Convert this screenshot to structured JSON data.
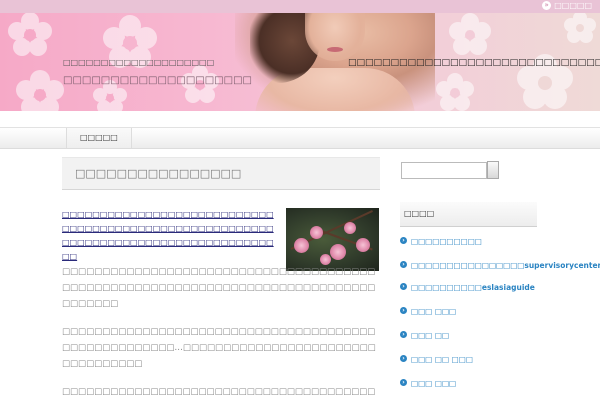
{
  "topbar": {
    "link_label": "□□□□□"
  },
  "header": {
    "site_subtitle": "□□□□□□□□□□□□□□□□□□□□",
    "site_title": "□□□□□□□□□□□□□□□□□□□□",
    "tagline": "□□□□□□□□□□□□□□□□□□□□□□□□□□□□□□□□"
  },
  "nav": {
    "items": [
      {
        "label": "□□□□□"
      }
    ]
  },
  "post": {
    "title": "□□□□□□□□□□□□□□□□",
    "intro": "□□□□□□□□□□□□□□□□□□□□□□□□□□□□□□□□□□□□□□□□□□□□□□□□□□□□□□□□□□□□□□□□□□□□□□□□□□□□□□□□□□□□□□",
    "paragraphs": [
      "□□□□□□□□□□□□□□□□□□□□□□□□□□□□□□□□□□□□□□□□□□□□□□□□□□□□□□□□□□□□□□□□□□□□□□□□□□□□□□□□□□□□□",
      "□□□□□□□□□□□□□□□□□□□□□□□□□□□□□□□□□□□□□□□□□□□□□□□□□□□□□…□□□□□□□□□□□□□□□□□□□□□□□□□□□□□□□□□□",
      "□□□□□□□□□□□□□□□□□□□□□□□□□□□□□□□□□□□□□□□"
    ]
  },
  "sidebar": {
    "widget_title": "□□□□",
    "items": [
      {
        "label": "□□□□□□□□□□"
      },
      {
        "label": "□□□□□□□□□□□□□□□□supervisorycenter"
      },
      {
        "label": "□□□□□□□□□□eslasiaguide"
      },
      {
        "label": "□□□ □□□"
      },
      {
        "label": "□□□ □□"
      },
      {
        "label": "□□□ □□ □□□"
      },
      {
        "label": "□□□ □□□"
      }
    ]
  },
  "colors": {
    "accent": "#2b84c2",
    "banner_pink": "#f6a9c7",
    "topbar": "#e9c3d6"
  }
}
